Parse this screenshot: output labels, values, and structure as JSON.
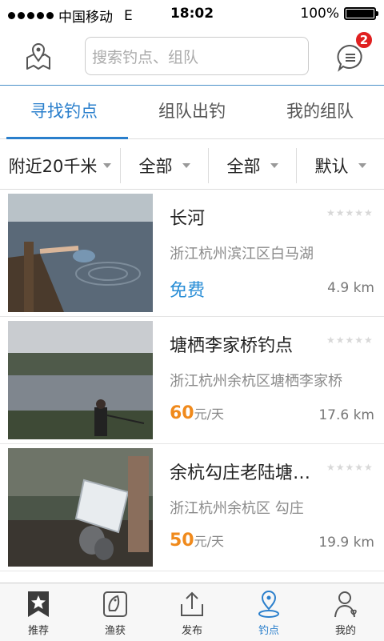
{
  "status_bar": {
    "carrier": "中国移动",
    "network": "E",
    "time": "18:02",
    "battery": "100%"
  },
  "header": {
    "search_placeholder": "搜索钓点、组队",
    "message_badge": "2"
  },
  "tabs": [
    {
      "label": "寻找钓点",
      "active": true
    },
    {
      "label": "组队出钓",
      "active": false
    },
    {
      "label": "我的组队",
      "active": false
    }
  ],
  "filters": [
    {
      "label": "附近20千米"
    },
    {
      "label": "全部"
    },
    {
      "label": "全部"
    },
    {
      "label": "默认"
    }
  ],
  "spots": [
    {
      "title": "长河",
      "address": "浙江杭州滨江区白马湖",
      "price": "免费",
      "free": true,
      "distance": "4.9 km",
      "rating": "★★★★★"
    },
    {
      "title": "塘栖李家桥钓点",
      "address": "浙江杭州余杭区塘栖李家桥",
      "price_num": "60",
      "price_unit": "元/天",
      "free": false,
      "distance": "17.6 km",
      "rating": "★★★★★"
    },
    {
      "title": "余杭勾庄老陆塘…",
      "address": "浙江杭州余杭区 勾庄",
      "price_num": "50",
      "price_unit": "元/天",
      "free": false,
      "distance": "19.9 km",
      "rating": "★★★★★"
    }
  ],
  "tabbar": [
    {
      "label": "推荐",
      "icon": "star-bookmark-icon"
    },
    {
      "label": "渔获",
      "icon": "fish-icon"
    },
    {
      "label": "发布",
      "icon": "upload-icon"
    },
    {
      "label": "钓点",
      "icon": "location-pin-icon",
      "active": true
    },
    {
      "label": "我的",
      "icon": "user-icon"
    }
  ],
  "colors": {
    "accent": "#2a7fcc",
    "price": "#f08a1c",
    "badge": "#e02020"
  }
}
